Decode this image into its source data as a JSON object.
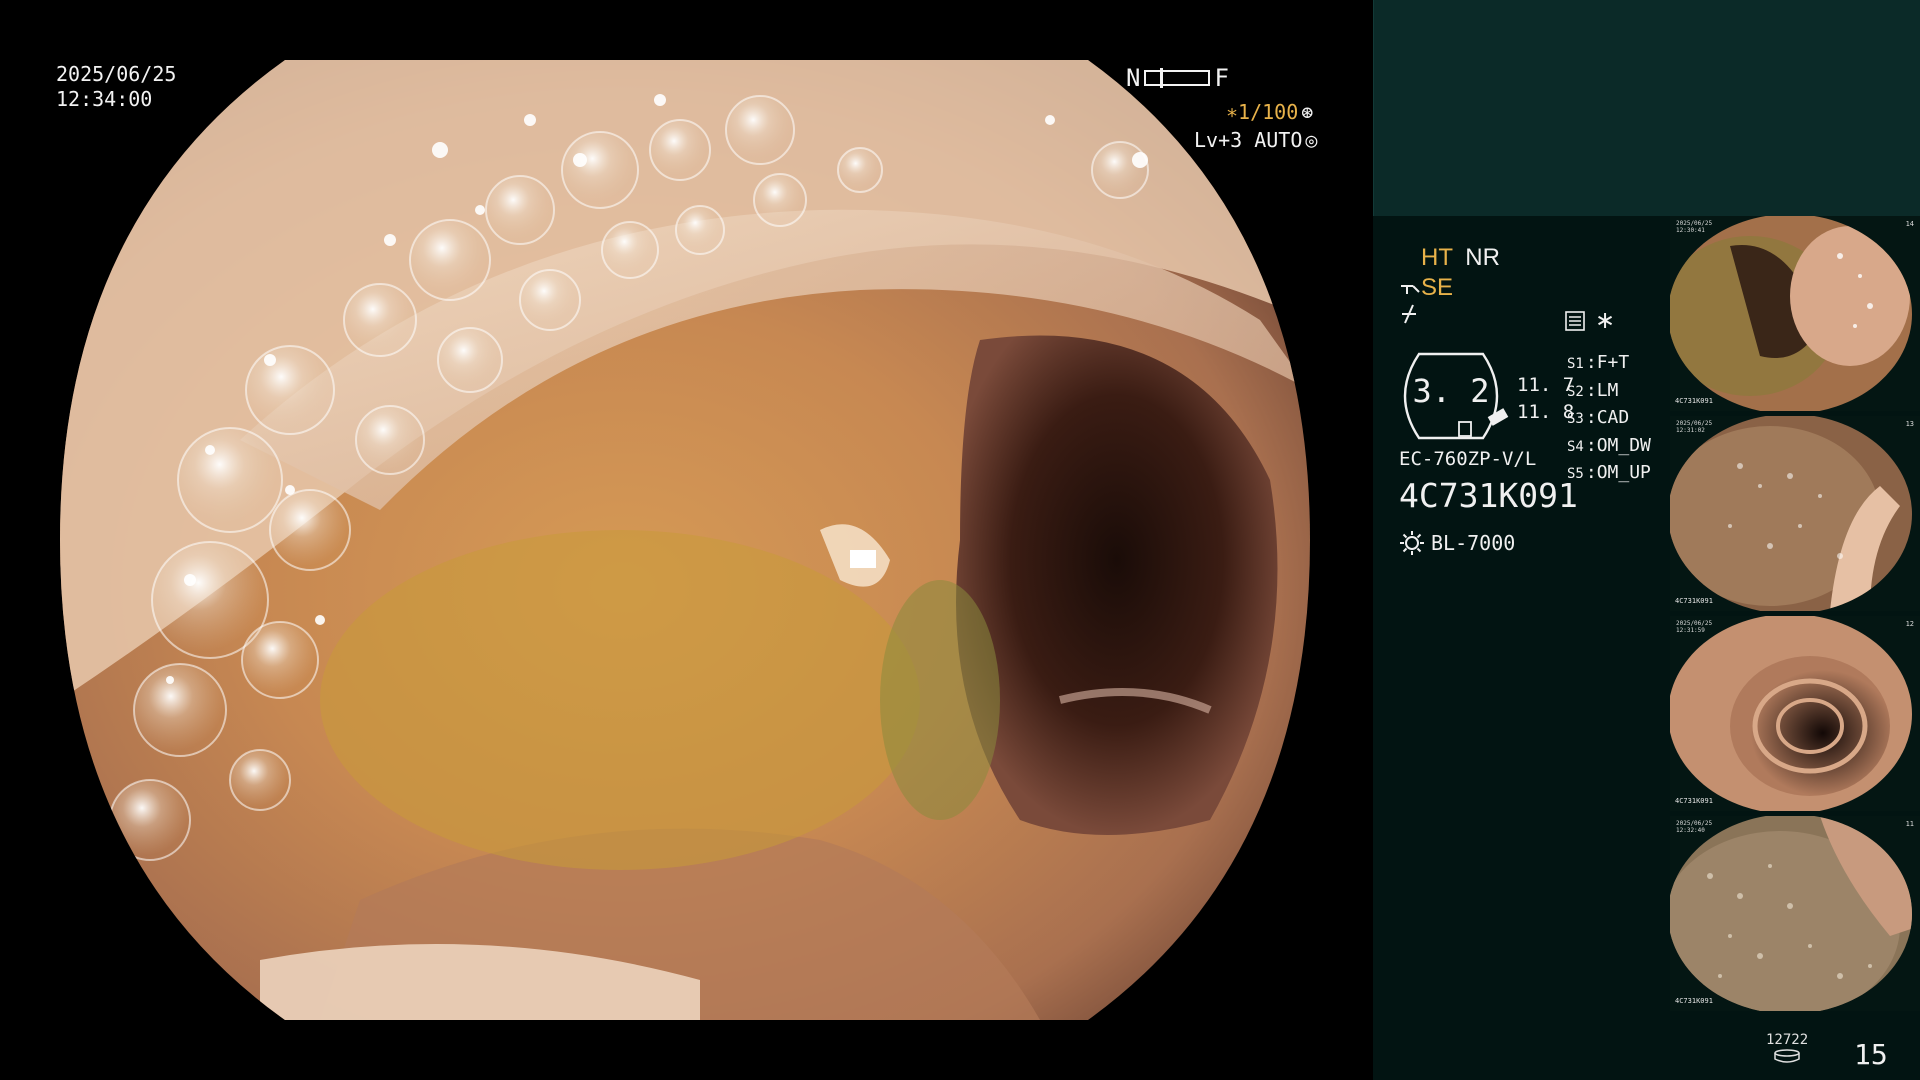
{
  "overlay": {
    "date": "2025/06/25",
    "time": "12:34:00",
    "near_label": "N",
    "far_label": "F",
    "shutter": "∗1/100",
    "shutter_icon": "shutter-icon",
    "iris": "Lv+3 AUTO",
    "iris_icon": "iris-icon"
  },
  "panel": {
    "mode_ht": "HT",
    "mode_nr": "NR",
    "se_label": "SE",
    "rec_asterisk": "∗",
    "zoom": "3. 2",
    "zoom_near": "11. 7",
    "zoom_far": "11. 8",
    "s_keys": [
      {
        "key": "S1",
        "value": "F+T"
      },
      {
        "key": "S2",
        "value": "LM"
      },
      {
        "key": "S3",
        "value": "CAD"
      },
      {
        "key": "S4",
        "value": "OM_DW"
      },
      {
        "key": "S5",
        "value": "OM_UP"
      }
    ],
    "scope_model": "EC-760ZP-V/L",
    "scope_serial": "4C731K091",
    "light_source": "BL-7000",
    "storage_count": "12722",
    "image_count": "15"
  },
  "thumbnails": [
    {
      "date": "2025/06/25",
      "time": "12:30:41",
      "serial": "4C731K091",
      "number": "14"
    },
    {
      "date": "2025/06/25",
      "time": "12:31:02",
      "serial": "4C731K091",
      "number": "13"
    },
    {
      "date": "2025/06/25",
      "time": "12:31:59",
      "serial": "4C731K091",
      "number": "12"
    },
    {
      "date": "2025/06/25",
      "time": "12:32:40",
      "serial": "4C731K091",
      "number": "11"
    }
  ],
  "colors": {
    "accent_orange": "#e8b24a",
    "panel_bg": "#021412",
    "panel_top_bg": "#0b2a28"
  }
}
